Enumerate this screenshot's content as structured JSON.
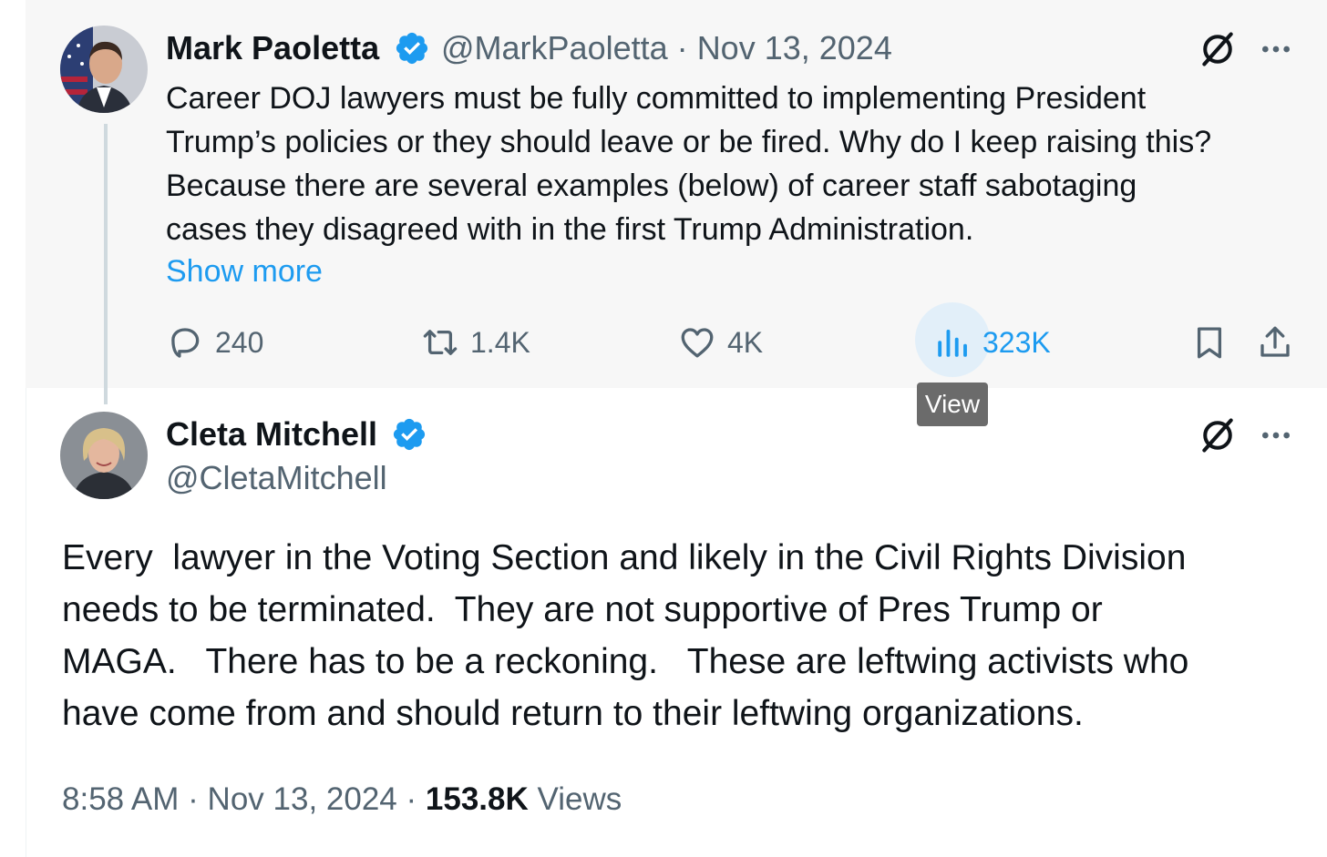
{
  "parent": {
    "name": "Mark Paoletta",
    "handle": "@MarkPaoletta",
    "separator": "·",
    "date": "Nov 13, 2024",
    "lines": [
      "Career DOJ lawyers must be fully committed to implementing President",
      "Trump’s policies or they should leave or be fired.  Why do I keep raising this?",
      "Because there are several examples (below) of career staff sabotaging",
      "cases they disagreed with in the first Trump Administration."
    ],
    "show_more": "Show more",
    "replies": "240",
    "reposts": "1.4K",
    "likes": "4K",
    "views": "323K",
    "tooltip": "View"
  },
  "main": {
    "name": "Cleta Mitchell",
    "handle": "@CletaMitchell",
    "lines": [
      "Every  lawyer in the Voting Section and likely in the Civil Rights Division",
      "needs to be terminated.  They are not supportive of Pres Trump or",
      "MAGA.   There has to be a reckoning.   These are leftwing activists who",
      "have come from and should return to their leftwing organizations."
    ],
    "time": "8:58 AM",
    "separator": "·",
    "date": "Nov 13, 2024",
    "views_count": "153.8K",
    "views_label": "Views"
  },
  "icons": {
    "verified": "verified-badge-icon",
    "grok": "grok-icon",
    "more": "more-icon",
    "reply": "reply-icon",
    "repost": "repost-icon",
    "like": "like-icon",
    "views": "views-icon",
    "bookmark": "bookmark-icon",
    "share": "share-icon"
  },
  "colors": {
    "accent": "#1d9bf0",
    "text": "#0f1419",
    "secondary": "#536471",
    "parent_bg": "#f7f7f7"
  }
}
